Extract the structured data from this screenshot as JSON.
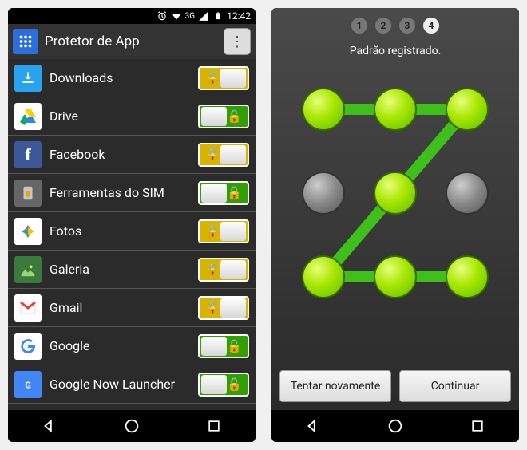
{
  "status": {
    "network_label": "3G",
    "time": "12:42"
  },
  "left": {
    "title": "Protetor de App",
    "apps": [
      {
        "label": "Downloads",
        "icon": "downloads",
        "locked": true
      },
      {
        "label": "Drive",
        "icon": "drive",
        "locked": false
      },
      {
        "label": "Facebook",
        "icon": "facebook",
        "locked": true
      },
      {
        "label": "Ferramentas do SIM",
        "icon": "sim",
        "locked": false
      },
      {
        "label": "Fotos",
        "icon": "photos",
        "locked": true
      },
      {
        "label": "Galeria",
        "icon": "gallery",
        "locked": true
      },
      {
        "label": "Gmail",
        "icon": "gmail",
        "locked": true
      },
      {
        "label": "Google",
        "icon": "google",
        "locked": false
      },
      {
        "label": "Google Now Launcher",
        "icon": "googlenow",
        "locked": false
      }
    ]
  },
  "right": {
    "steps": [
      "1",
      "2",
      "3",
      "4"
    ],
    "active_step": 4,
    "message": "Padrão registrado.",
    "buttons": {
      "retry": "Tentar novamente",
      "continue": "Continuar"
    },
    "pattern": {
      "selected": [
        0,
        1,
        2,
        4,
        6,
        7,
        8
      ],
      "path": [
        [
          0,
          0
        ],
        [
          1,
          0
        ],
        [
          2,
          0
        ],
        [
          0,
          2
        ],
        [
          1,
          2
        ],
        [
          2,
          2
        ]
      ]
    }
  },
  "icon_colors": {
    "downloads": "#29a3ef",
    "drive": "#fff",
    "facebook": "#3b5998",
    "sim": "#666",
    "photos": "#fff",
    "gallery": "#3a7a3a",
    "gmail": "#fff",
    "google": "#fff",
    "googlenow": "#4285f4"
  }
}
